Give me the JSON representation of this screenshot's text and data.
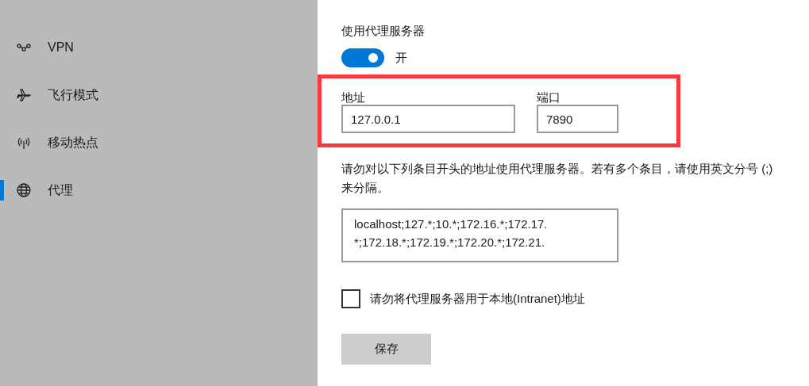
{
  "sidebar": {
    "items": [
      {
        "label": "VPN",
        "kind": "vpn",
        "selected": false
      },
      {
        "label": "飞行模式",
        "kind": "airplane",
        "selected": false
      },
      {
        "label": "移动热点",
        "kind": "hotspot",
        "selected": false
      },
      {
        "label": "代理",
        "kind": "globe",
        "selected": true
      }
    ]
  },
  "proxy": {
    "title": "使用代理服务器",
    "toggle": {
      "on": true,
      "label": "开"
    },
    "address": {
      "label": "地址",
      "value": "127.0.0.1"
    },
    "port": {
      "label": "端口",
      "value": "7890"
    },
    "description": "请勿对以下列条目开头的地址使用代理服务器。若有多个条目，请使用英文分号 (;) 来分隔。",
    "exceptions": [
      "localhost;127.*;10.*;172.16.*;172.17.",
      "*;172.18.*;172.19.*;172.20.*;172.21."
    ],
    "local_bypass": {
      "label": "请勿将代理服务器用于本地(Intranet)地址",
      "checked": false
    },
    "save_button": "保存"
  }
}
